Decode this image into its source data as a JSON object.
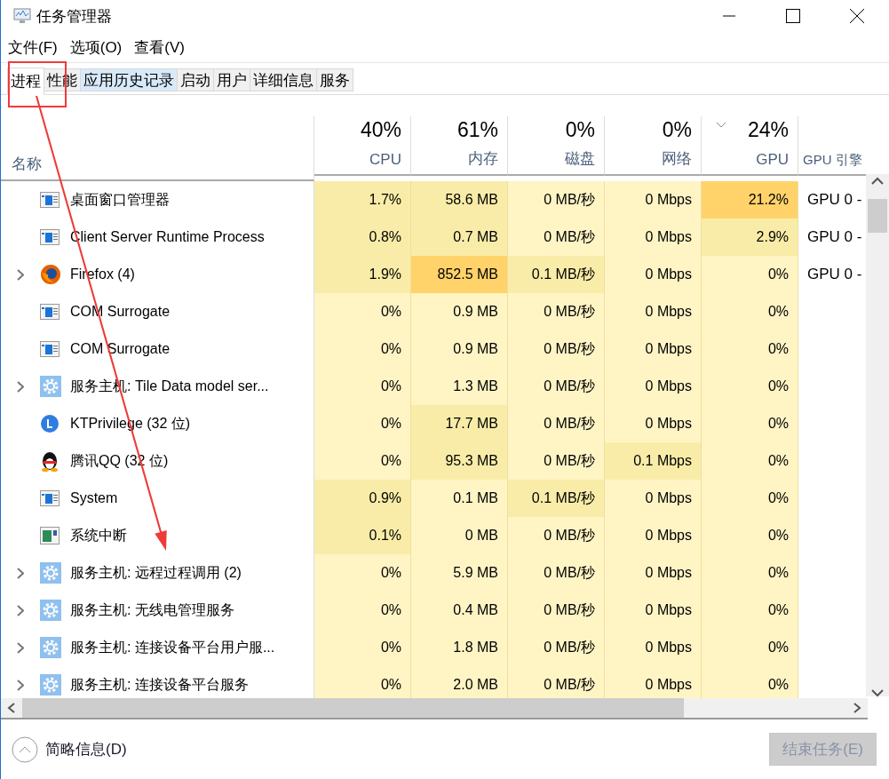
{
  "window": {
    "title": "任务管理器"
  },
  "menu": [
    "文件(F)",
    "选项(O)",
    "查看(V)"
  ],
  "tabs": [
    {
      "label": "进程",
      "selected": true,
      "hovered": false
    },
    {
      "label": "性能",
      "selected": false,
      "hovered": false
    },
    {
      "label": "应用历史记录",
      "selected": false,
      "hovered": true
    },
    {
      "label": "启动",
      "selected": false,
      "hovered": false
    },
    {
      "label": "用户",
      "selected": false,
      "hovered": false
    },
    {
      "label": "详细信息",
      "selected": false,
      "hovered": false
    },
    {
      "label": "服务",
      "selected": false,
      "hovered": false
    }
  ],
  "table": {
    "name_column": "名称",
    "columns": [
      {
        "percent": "40%",
        "label": "CPU",
        "sorted": false
      },
      {
        "percent": "61%",
        "label": "内存",
        "sorted": false
      },
      {
        "percent": "0%",
        "label": "磁盘",
        "sorted": false
      },
      {
        "percent": "0%",
        "label": "网络",
        "sorted": false
      },
      {
        "percent": "24%",
        "label": "GPU",
        "sorted": true
      }
    ],
    "engine_column": "GPU 引擎",
    "rows": [
      {
        "name": "桌面窗口管理器",
        "kind": "window",
        "expandable": false,
        "cells": [
          {
            "text": "1.7%",
            "color": "#f9eca8"
          },
          {
            "text": "58.6 MB",
            "color": "#f9eca8"
          },
          {
            "text": "0 MB/秒",
            "color": "#fff4c4"
          },
          {
            "text": "0 Mbps",
            "color": "#fff4c4"
          },
          {
            "text": "21.2%",
            "color": "#ffd26a"
          }
        ],
        "engine": "GPU 0 -"
      },
      {
        "name": "Client Server Runtime Process",
        "kind": "window",
        "expandable": false,
        "cells": [
          {
            "text": "0.8%",
            "color": "#f9eca8"
          },
          {
            "text": "0.7 MB",
            "color": "#f9eca8"
          },
          {
            "text": "0 MB/秒",
            "color": "#fff4c4"
          },
          {
            "text": "0 Mbps",
            "color": "#fff4c4"
          },
          {
            "text": "2.9%",
            "color": "#f9eca8"
          }
        ],
        "engine": "GPU 0 -"
      },
      {
        "name": "Firefox (4)",
        "kind": "firefox",
        "expandable": true,
        "cells": [
          {
            "text": "1.9%",
            "color": "#f9eca8"
          },
          {
            "text": "852.5 MB",
            "color": "#ffd26a"
          },
          {
            "text": "0.1 MB/秒",
            "color": "#f9eca8"
          },
          {
            "text": "0 Mbps",
            "color": "#fff4c4"
          },
          {
            "text": "0%",
            "color": "#fff4c4"
          }
        ],
        "engine": "GPU 0 -"
      },
      {
        "name": "COM Surrogate",
        "kind": "window",
        "expandable": false,
        "cells": [
          {
            "text": "0%",
            "color": "#fff4c4"
          },
          {
            "text": "0.9 MB",
            "color": "#fff4c4"
          },
          {
            "text": "0 MB/秒",
            "color": "#fff4c4"
          },
          {
            "text": "0 Mbps",
            "color": "#fff4c4"
          },
          {
            "text": "0%",
            "color": "#fff4c4"
          }
        ]
      },
      {
        "name": "COM Surrogate",
        "kind": "window",
        "expandable": false,
        "cells": [
          {
            "text": "0%",
            "color": "#fff4c4"
          },
          {
            "text": "0.9 MB",
            "color": "#fff4c4"
          },
          {
            "text": "0 MB/秒",
            "color": "#fff4c4"
          },
          {
            "text": "0 Mbps",
            "color": "#fff4c4"
          },
          {
            "text": "0%",
            "color": "#fff4c4"
          }
        ]
      },
      {
        "name": "服务主机: Tile Data model ser...",
        "kind": "gear",
        "expandable": true,
        "cells": [
          {
            "text": "0%",
            "color": "#fff4c4"
          },
          {
            "text": "1.3 MB",
            "color": "#fff4c4"
          },
          {
            "text": "0 MB/秒",
            "color": "#fff4c4"
          },
          {
            "text": "0 Mbps",
            "color": "#fff4c4"
          },
          {
            "text": "0%",
            "color": "#fff4c4"
          }
        ]
      },
      {
        "name": "KTPrivilege (32 位)",
        "kind": "letter",
        "expandable": false,
        "cells": [
          {
            "text": "0%",
            "color": "#fff4c4"
          },
          {
            "text": "17.7 MB",
            "color": "#f9eca8"
          },
          {
            "text": "0 MB/秒",
            "color": "#fff4c4"
          },
          {
            "text": "0 Mbps",
            "color": "#fff4c4"
          },
          {
            "text": "0%",
            "color": "#fff4c4"
          }
        ]
      },
      {
        "name": "腾讯QQ (32 位)",
        "kind": "penguin",
        "expandable": false,
        "cells": [
          {
            "text": "0%",
            "color": "#fff4c4"
          },
          {
            "text": "95.3 MB",
            "color": "#f9eca8"
          },
          {
            "text": "0 MB/秒",
            "color": "#fff4c4"
          },
          {
            "text": "0.1 Mbps",
            "color": "#f9eca8"
          },
          {
            "text": "0%",
            "color": "#fff4c4"
          }
        ]
      },
      {
        "name": "System",
        "kind": "window",
        "expandable": false,
        "cells": [
          {
            "text": "0.9%",
            "color": "#f9eca8"
          },
          {
            "text": "0.1 MB",
            "color": "#fff4c4"
          },
          {
            "text": "0.1 MB/秒",
            "color": "#f9eca8"
          },
          {
            "text": "0 Mbps",
            "color": "#fff4c4"
          },
          {
            "text": "0%",
            "color": "#fff4c4"
          }
        ]
      },
      {
        "name": "系统中断",
        "kind": "interrupt",
        "expandable": false,
        "cells": [
          {
            "text": "0.1%",
            "color": "#f9eca8"
          },
          {
            "text": "0 MB",
            "color": "#fff4c4"
          },
          {
            "text": "0 MB/秒",
            "color": "#fff4c4"
          },
          {
            "text": "0 Mbps",
            "color": "#fff4c4"
          },
          {
            "text": "0%",
            "color": "#fff4c4"
          }
        ]
      },
      {
        "name": "服务主机: 远程过程调用 (2)",
        "kind": "gear",
        "expandable": true,
        "cells": [
          {
            "text": "0%",
            "color": "#fff4c4"
          },
          {
            "text": "5.9 MB",
            "color": "#fff4c4"
          },
          {
            "text": "0 MB/秒",
            "color": "#fff4c4"
          },
          {
            "text": "0 Mbps",
            "color": "#fff4c4"
          },
          {
            "text": "0%",
            "color": "#fff4c4"
          }
        ]
      },
      {
        "name": "服务主机: 无线电管理服务",
        "kind": "gear",
        "expandable": true,
        "cells": [
          {
            "text": "0%",
            "color": "#fff4c4"
          },
          {
            "text": "0.4 MB",
            "color": "#fff4c4"
          },
          {
            "text": "0 MB/秒",
            "color": "#fff4c4"
          },
          {
            "text": "0 Mbps",
            "color": "#fff4c4"
          },
          {
            "text": "0%",
            "color": "#fff4c4"
          }
        ]
      },
      {
        "name": "服务主机: 连接设备平台用户服...",
        "kind": "gear",
        "expandable": true,
        "cells": [
          {
            "text": "0%",
            "color": "#fff4c4"
          },
          {
            "text": "1.8 MB",
            "color": "#fff4c4"
          },
          {
            "text": "0 MB/秒",
            "color": "#fff4c4"
          },
          {
            "text": "0 Mbps",
            "color": "#fff4c4"
          },
          {
            "text": "0%",
            "color": "#fff4c4"
          }
        ]
      },
      {
        "name": "服务主机: 连接设备平台服务",
        "kind": "gear",
        "expandable": true,
        "cells": [
          {
            "text": "0%",
            "color": "#fff4c4"
          },
          {
            "text": "2.0 MB",
            "color": "#fff4c4"
          },
          {
            "text": "0 MB/秒",
            "color": "#fff4c4"
          },
          {
            "text": "0 Mbps",
            "color": "#fff4c4"
          },
          {
            "text": "0%",
            "color": "#fff4c4"
          }
        ]
      }
    ]
  },
  "footer": {
    "details_toggle": "简略信息(D)",
    "end_task": {
      "label": "结束任务(E)",
      "disabled": true
    }
  }
}
